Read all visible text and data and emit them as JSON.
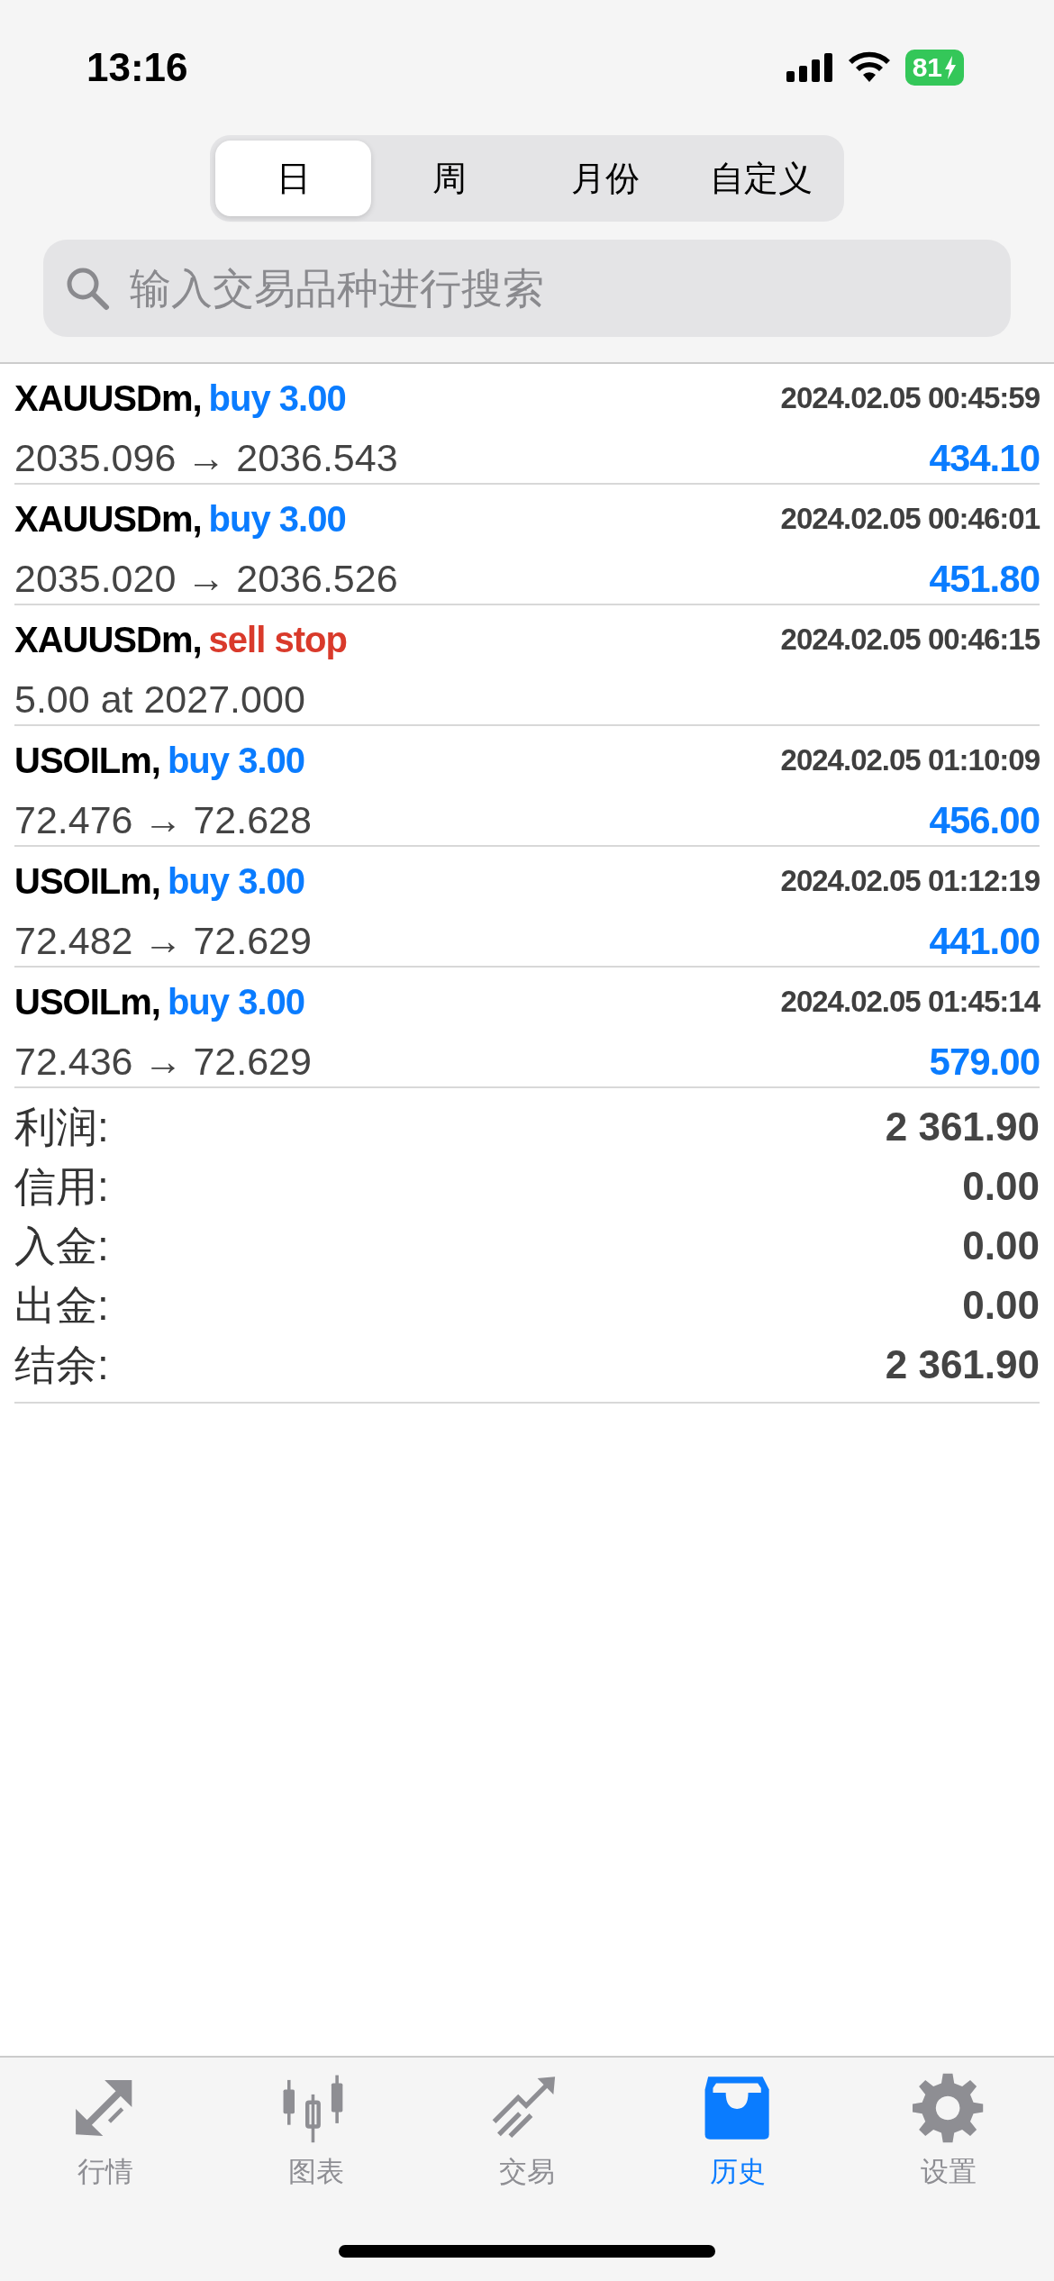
{
  "status_bar": {
    "time": "13:16",
    "battery": "81"
  },
  "tabs": [
    {
      "label": "日",
      "selected": true
    },
    {
      "label": "周",
      "selected": false
    },
    {
      "label": "月份",
      "selected": false
    },
    {
      "label": "自定义",
      "selected": false
    }
  ],
  "search": {
    "placeholder": "输入交易品种进行搜索"
  },
  "trades": [
    {
      "symbol": "XAUUSDm,",
      "action": "buy 3.00",
      "kind": "buy",
      "time": "2024.02.05 00:45:59",
      "prices": "2035.096 → 2036.543",
      "profit": "434.10"
    },
    {
      "symbol": "XAUUSDm,",
      "action": "buy 3.00",
      "kind": "buy",
      "time": "2024.02.05 00:46:01",
      "prices": "2035.020 → 2036.526",
      "profit": "451.80"
    },
    {
      "symbol": "XAUUSDm,",
      "action": "sell stop",
      "kind": "sell",
      "time": "2024.02.05 00:46:15",
      "prices": "5.00 at 2027.000"
    },
    {
      "symbol": "USOILm,",
      "action": "buy 3.00",
      "kind": "buy",
      "time": "2024.02.05 01:10:09",
      "prices": "72.476 → 72.628",
      "profit": "456.00"
    },
    {
      "symbol": "USOILm,",
      "action": "buy 3.00",
      "kind": "buy",
      "time": "2024.02.05 01:12:19",
      "prices": "72.482 → 72.629",
      "profit": "441.00"
    },
    {
      "symbol": "USOILm,",
      "action": "buy 3.00",
      "kind": "buy",
      "time": "2024.02.05 01:45:14",
      "prices": "72.436 → 72.629",
      "profit": "579.00"
    }
  ],
  "summary": [
    {
      "label": "利润:",
      "value": "2 361.90"
    },
    {
      "label": "信用:",
      "value": "0.00"
    },
    {
      "label": "入金:",
      "value": "0.00"
    },
    {
      "label": "出金:",
      "value": "0.00"
    },
    {
      "label": "结余:",
      "value": "2 361.90"
    }
  ],
  "nav": [
    {
      "kind": "quotes",
      "label": "行情",
      "selected": false
    },
    {
      "kind": "chart",
      "label": "图表",
      "selected": false
    },
    {
      "kind": "trade",
      "label": "交易",
      "selected": false
    },
    {
      "kind": "history",
      "label": "历史",
      "selected": true
    },
    {
      "kind": "settings",
      "label": "设置",
      "selected": false
    }
  ]
}
